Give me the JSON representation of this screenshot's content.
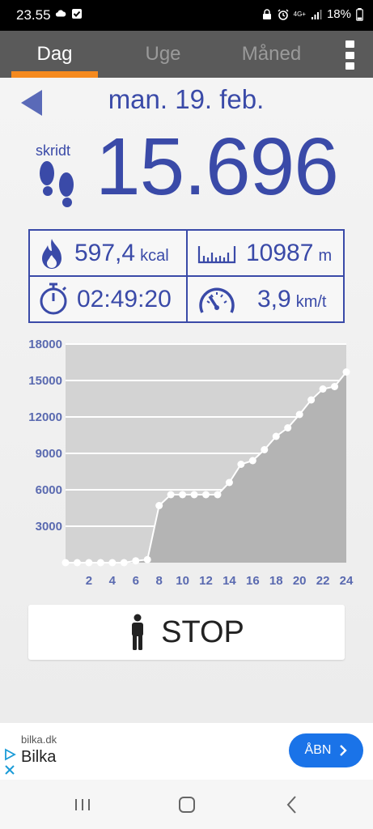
{
  "status_bar": {
    "time": "23.55",
    "battery": "18%",
    "network": "4G+",
    "left_icons": [
      "cloud-icon",
      "checkbox-icon"
    ],
    "right_icons": [
      "lock-icon",
      "alarm-icon",
      "signal-icon",
      "battery-icon"
    ]
  },
  "tabs": [
    {
      "label": "Dag",
      "active": true
    },
    {
      "label": "Uge",
      "active": false
    },
    {
      "label": "Måned",
      "active": false
    }
  ],
  "date_nav": {
    "date": "man. 19. feb.",
    "back_icon": "left-triangle-icon"
  },
  "steps": {
    "label": "skridt",
    "value": "15.696",
    "icon": "footprints-icon"
  },
  "stats": {
    "calories": {
      "value": "597,4",
      "unit": "kcal",
      "icon": "flame-icon"
    },
    "distance": {
      "value": "10987",
      "unit": "m",
      "icon": "ruler-icon"
    },
    "duration": {
      "value": "02:49:20",
      "icon": "stopwatch-icon"
    },
    "speed": {
      "value": "3,9",
      "unit": "km/t",
      "icon": "speedometer-icon"
    }
  },
  "chart_data": {
    "type": "area",
    "x": [
      0,
      1,
      2,
      3,
      4,
      5,
      6,
      7,
      8,
      9,
      10,
      11,
      12,
      13,
      14,
      15,
      16,
      17,
      18,
      19,
      20,
      21,
      22,
      23,
      24
    ],
    "values": [
      0,
      0,
      0,
      0,
      0,
      0,
      150,
      250,
      4700,
      5600,
      5600,
      5600,
      5600,
      5600,
      6600,
      8100,
      8400,
      9300,
      10400,
      11100,
      12200,
      13400,
      14300,
      14500,
      15700
    ],
    "xticks": [
      2,
      4,
      6,
      8,
      10,
      12,
      14,
      16,
      18,
      20,
      22,
      24
    ],
    "yticks": [
      3000,
      6000,
      9000,
      12000,
      15000,
      18000
    ],
    "xlim": [
      0,
      24
    ],
    "ylim": [
      0,
      18000
    ],
    "grid": true,
    "colors": {
      "area": "#b4b4b4",
      "plot_bg": "#d3d3d3",
      "line": "#ffffff",
      "tick_labels": "#5a6ab0"
    }
  },
  "stop_button": {
    "label": "STOP",
    "icon": "person-icon"
  },
  "ad": {
    "domain": "bilka.dk",
    "name": "Bilka",
    "button_label": "ÅBN",
    "button_icon": "chevron-right-icon",
    "badge_icons": [
      "adchoices-icon",
      "close-icon"
    ]
  },
  "nav_bar": {
    "buttons": [
      "recents-icon",
      "home-icon",
      "back-icon"
    ]
  },
  "colors": {
    "accent": "#3a4aa8",
    "tab_indicator": "#f58a1f",
    "tab_bar": "#5a5a5a",
    "ad_button": "#1a73e8"
  }
}
